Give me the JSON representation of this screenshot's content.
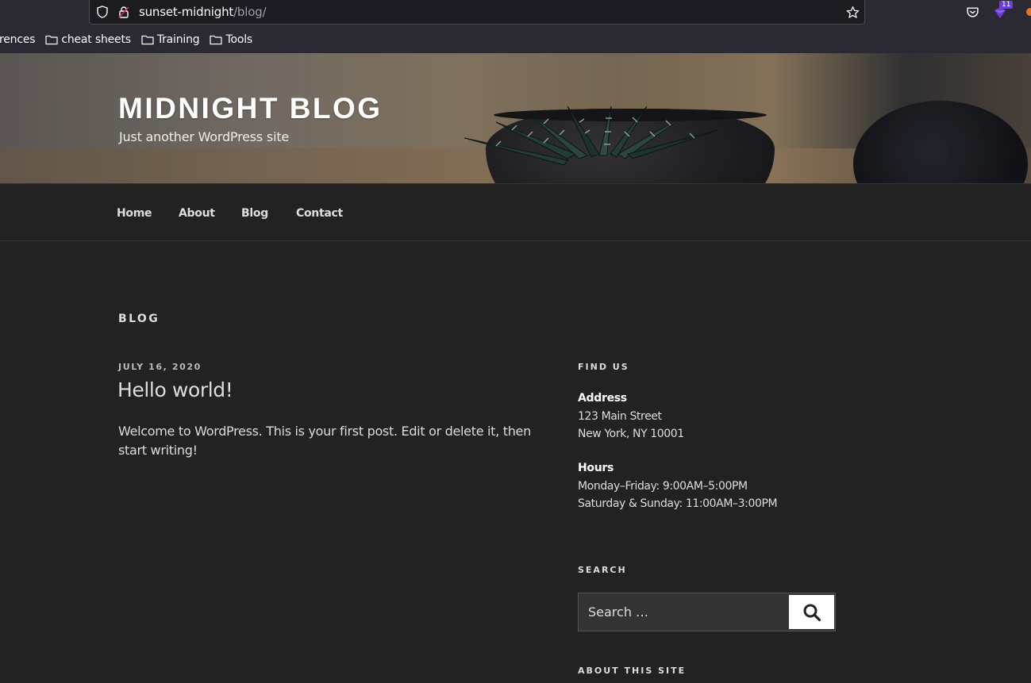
{
  "browser": {
    "url_host": "sunset-midnight",
    "url_path": "/blog/",
    "extension_badge": "11",
    "bookmarks": [
      {
        "label": "rences"
      },
      {
        "label": "cheat sheets"
      },
      {
        "label": "Training"
      },
      {
        "label": "Tools"
      }
    ]
  },
  "site": {
    "title": "MIDNIGHT BLOG",
    "description": "Just another WordPress site"
  },
  "nav": {
    "items": [
      {
        "label": "Home"
      },
      {
        "label": "About"
      },
      {
        "label": "Blog"
      },
      {
        "label": "Contact"
      }
    ]
  },
  "main": {
    "section_title": "BLOG",
    "post": {
      "date": "JULY 16, 2020",
      "title": "Hello world!",
      "excerpt": "Welcome to WordPress. This is your first post. Edit or delete it, then start writing!"
    }
  },
  "sidebar": {
    "find_us": {
      "title": "FIND US",
      "address_label": "Address",
      "address_line1": "123 Main Street",
      "address_line2": "New York, NY 10001",
      "hours_label": "Hours",
      "hours_line1": "Monday–Friday: 9:00AM–5:00PM",
      "hours_line2": "Saturday & Sunday: 11:00AM–3:00PM"
    },
    "search": {
      "title": "SEARCH",
      "placeholder": "Search …"
    },
    "about": {
      "title": "ABOUT THIS SITE"
    }
  }
}
